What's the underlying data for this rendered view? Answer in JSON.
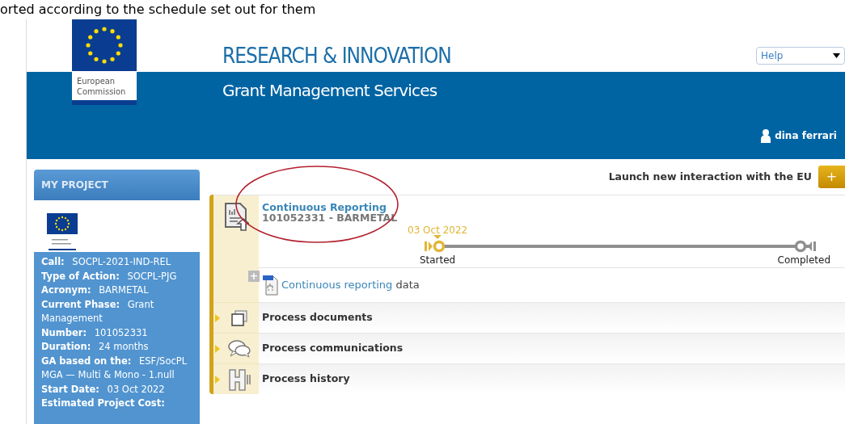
{
  "caption": "orted according to the schedule set out for them",
  "header": {
    "logo_text": "European Commission",
    "title": "RESEARCH & INNOVATION",
    "subtitle": "Grant Management Services",
    "help_select": {
      "value": "Help"
    },
    "user": "dina ferrari"
  },
  "sidebar": {
    "title": "MY PROJECT",
    "fields": [
      {
        "label": "Call:",
        "value": "SOCPL-2021-IND-REL"
      },
      {
        "label": "Type of Action:",
        "value": "SOCPL-PJG"
      },
      {
        "label": "Acronym:",
        "value": "BARMETAL"
      },
      {
        "label": "Current Phase:",
        "value": "Grant Management"
      },
      {
        "label": "Number:",
        "value": "101052331"
      },
      {
        "label": "Duration:",
        "value": "24 months"
      },
      {
        "label": "GA based on the:",
        "value": "ESF/SocPL MGA — Multi & Mono - 1.null"
      },
      {
        "label": "Start Date:",
        "value": "03 Oct 2022"
      },
      {
        "label": "Estimated Project Cost:"
      }
    ]
  },
  "launch": {
    "label": "Launch new interaction with the EU",
    "button": "+"
  },
  "process": {
    "title": "Continuous Reporting",
    "subtitle": "101052331 - BARMETAL",
    "annotated": true,
    "milestones": [
      {
        "label": "Started",
        "date": "03 Oct 2022",
        "current": true
      },
      {
        "label": "Completed",
        "current": false
      }
    ],
    "data_row": {
      "expand": "+",
      "link": "Continuous reporting",
      "text": "data"
    },
    "sections": [
      {
        "kind": "documents",
        "label": "Process documents",
        "expanded": false
      },
      {
        "kind": "communications",
        "label": "Process communications",
        "expanded": false
      },
      {
        "kind": "history",
        "label": "Process history",
        "expanded": false
      }
    ]
  }
}
